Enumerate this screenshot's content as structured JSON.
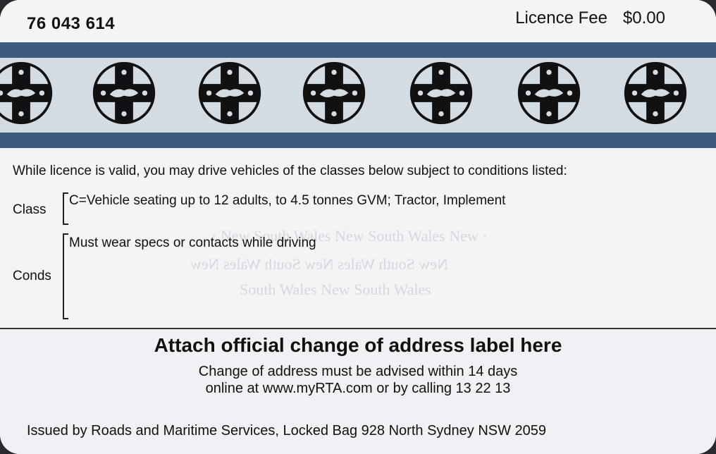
{
  "card": {
    "licence_number": "76 043 614",
    "fee_label": "Licence Fee",
    "fee_value": "$0.00",
    "intro": "While licence is valid, you may drive vehicles of the classes below subject to conditions listed:",
    "class_label": "Class",
    "class_value": "C=Vehicle seating up to 12 adults, to 4.5 tonnes GVM; Tractor, Implement",
    "conds_label": "Conds",
    "conds_value": "Must wear specs or contacts while driving",
    "attach_heading": "Attach official change of address label here",
    "notice_line1": "Change of address must be advised within 14 days",
    "notice_line2": "online at www.myRTA.com or by calling 13 22 13",
    "issued_by": "Issued by Roads and Maritime Services, Locked Bag 928 North Sydney NSW 2059"
  },
  "emblems": [
    "nsw-emblem-icon",
    "nsw-emblem-icon",
    "nsw-emblem-icon",
    "nsw-emblem-icon",
    "nsw-emblem-icon",
    "nsw-emblem-icon",
    "nsw-emblem-icon"
  ],
  "colors": {
    "band": "#3c5b7e",
    "card": "#eff1f4",
    "text": "#111111"
  }
}
